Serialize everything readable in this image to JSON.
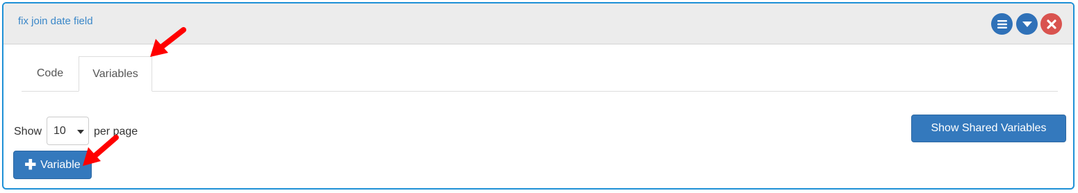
{
  "panel": {
    "title": "fix join date field",
    "header_buttons": [
      {
        "icon": "menu-icon",
        "color": "#2f71b8"
      },
      {
        "icon": "chevron-down-icon",
        "color": "#2f71b8"
      },
      {
        "icon": "close-icon",
        "color": "#d9534f"
      }
    ]
  },
  "tabs": [
    {
      "label": "Code",
      "active": false
    },
    {
      "label": "Variables",
      "active": true
    }
  ],
  "pagination": {
    "show_label": "Show",
    "page_size": "10",
    "per_page_label": "per page"
  },
  "buttons": {
    "show_shared": "Show Shared Variables",
    "add_variable": "Variable"
  },
  "annotations": {
    "arrow_color": "#ff0000"
  },
  "colors": {
    "accent": "#3479bd",
    "border": "#1e90d6",
    "danger": "#d9534f"
  }
}
